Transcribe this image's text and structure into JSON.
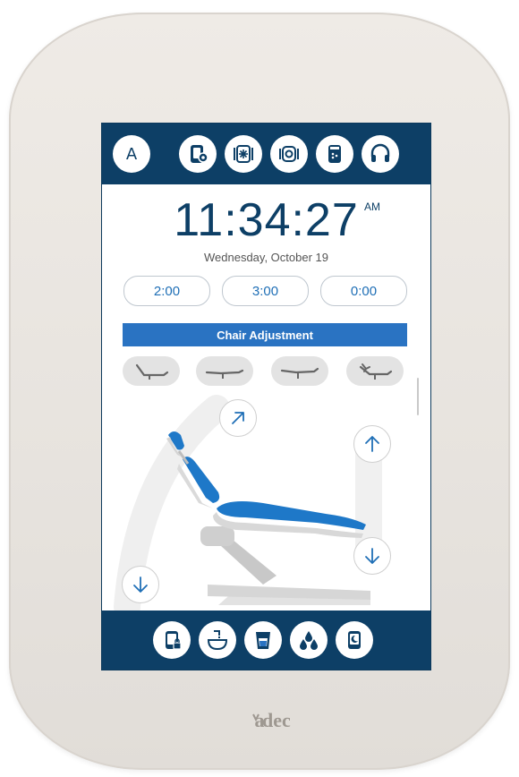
{
  "topbar": {
    "profile_label": "A",
    "icons": [
      "settings-icon",
      "sterilize-icon",
      "light-icon",
      "dispense-icon",
      "headset-icon"
    ]
  },
  "clock": {
    "time": "11:34:27",
    "ampm": "AM",
    "date": "Wednesday, October 19"
  },
  "timers": [
    "2:00",
    "3:00",
    "0:00"
  ],
  "chair": {
    "section_title": "Chair Adjustment",
    "presets": [
      "entry-exit-position",
      "lower-position",
      "upper-position",
      "custom-position"
    ],
    "controls": [
      "tilt-back-arrow",
      "tilt-forward-arrow",
      "base-up-arrow",
      "base-down-arrow"
    ]
  },
  "bottombar": {
    "icons": [
      "lock-icon",
      "cuspidor-icon",
      "cup-fill-icon",
      "water-icon",
      "sleep-icon"
    ]
  },
  "brand": {
    "logo": "a-dec",
    "colors": {
      "bar": "#0d3f66",
      "accent": "#2a73c2",
      "chair": "#1e78c8"
    }
  }
}
